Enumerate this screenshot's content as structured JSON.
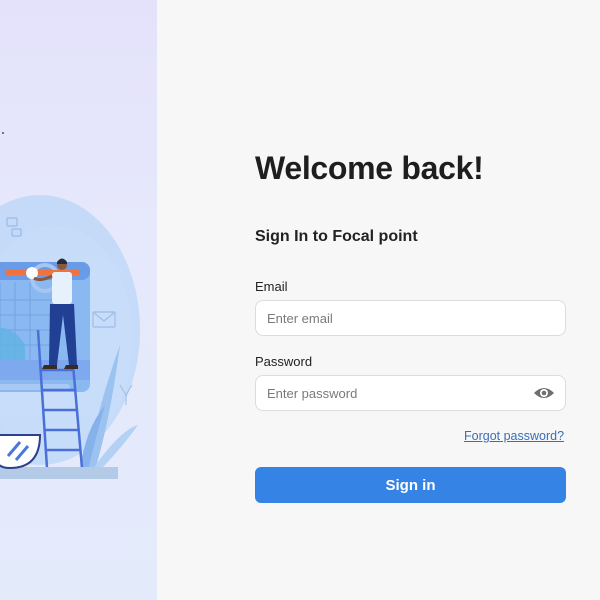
{
  "login": {
    "title": "Welcome back!",
    "subtitle": "Sign In to Focal point",
    "email": {
      "label": "Email",
      "placeholder": "Enter email",
      "value": ""
    },
    "password": {
      "label": "Password",
      "placeholder": "Enter password",
      "value": "",
      "toggle_icon": "eye-icon"
    },
    "forgot_link": "Forgot password?",
    "submit_label": "Sign in"
  },
  "illustration": {
    "icon": "person-on-ladder-illustration"
  },
  "colors": {
    "primary": "#3583e5",
    "link": "#3a6fb8",
    "left_panel_bg": "#e5e6fb",
    "page_bg": "#f7f7f7",
    "accent_orange": "#f0733f"
  }
}
